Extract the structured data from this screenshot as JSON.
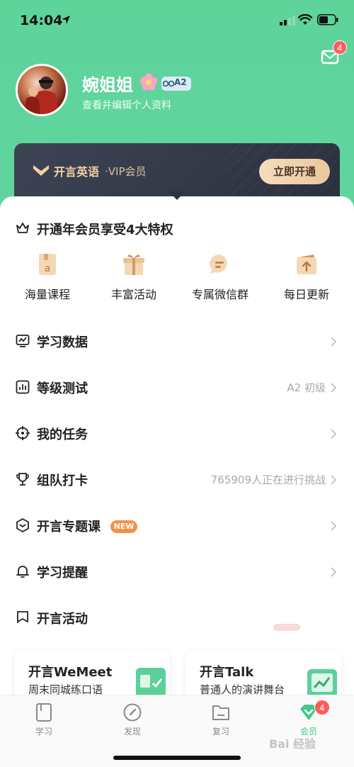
{
  "status": {
    "time": "14:04"
  },
  "header": {
    "mail_badge": "4"
  },
  "profile": {
    "name": "婉姐姐",
    "level": "A2",
    "subtitle": "查看并编辑个人资料"
  },
  "vip": {
    "brand": "开言英语",
    "title": "·VIP会员",
    "button": "立即开通"
  },
  "benefits": {
    "heading": "开通年会员享受4大特权",
    "items": [
      {
        "label": "海量课程",
        "icon": "book-a-icon"
      },
      {
        "label": "丰富活动",
        "icon": "gift-icon"
      },
      {
        "label": "专属微信群",
        "icon": "chat-bubble-icon"
      },
      {
        "label": "每日更新",
        "icon": "upload-box-icon"
      }
    ]
  },
  "menu": [
    {
      "title": "学习数据",
      "value": "",
      "icon": "chart-monitor-icon"
    },
    {
      "title": "等级测试",
      "value": "A2 初级",
      "icon": "bar-chart-icon"
    },
    {
      "title": "我的任务",
      "value": "",
      "icon": "target-icon"
    },
    {
      "title": "组队打卡",
      "value": "765909人正在进行挑战",
      "icon": "trophy-icon"
    },
    {
      "title": "开言专题课",
      "value": "",
      "badge": "NEW",
      "icon": "hexagon-icon"
    },
    {
      "title": "学习提醒",
      "value": "",
      "icon": "bell-icon"
    },
    {
      "title": "开言活动",
      "value": "",
      "icon": "flag-icon"
    }
  ],
  "promos": [
    {
      "title": "开言WeMeet",
      "subtitle": "周末同城练口语"
    },
    {
      "title": "开言Talk",
      "subtitle": "普通人的演讲舞台"
    }
  ],
  "tabs": [
    {
      "label": "学习",
      "icon": "book-icon"
    },
    {
      "label": "发现",
      "icon": "compass-icon"
    },
    {
      "label": "复习",
      "icon": "folder-icon"
    },
    {
      "label": "会员",
      "icon": "diamond-heart-icon",
      "badge": "4"
    }
  ],
  "watermark": "Bai 经验",
  "colors": {
    "brand_green": "#5ed39a",
    "vip_dark": "#2b303d",
    "vip_gold": "#f1d2a6",
    "badge_red": "#ff5a5a",
    "new_orange": "#f39146"
  }
}
